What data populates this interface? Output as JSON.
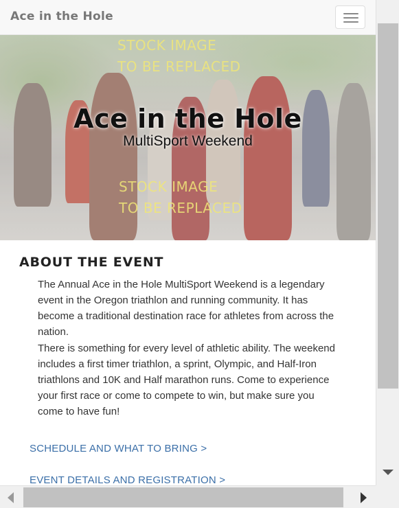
{
  "navbar": {
    "brand": "Ace in the Hole",
    "toggle_icon": "hamburger-menu-icon"
  },
  "hero": {
    "stock_top_line1": "STOCK IMAGE",
    "stock_top_line2": "TO BE REPLACED",
    "title": "Ace in the Hole",
    "subtitle": "MultiSport Weekend",
    "stock_bottom_line1": "STOCK IMAGE",
    "stock_bottom_line2": "TO BE REPLACED"
  },
  "about": {
    "heading": "ABOUT THE EVENT",
    "paragraph1": "The Annual Ace in the Hole MultiSport Weekend is a legendary event in the Oregon triathlon and running community. It has become a traditional destination race for athletes from across the nation.",
    "paragraph2": "There is something for every level of athletic ability. The weekend includes a first timer triathlon, a sprint, Olympic, and Half-Iron triathlons and 10K and Half marathon runs. Come to experience your first race or come to compete to win, but make sure you come to have fun!"
  },
  "links": {
    "schedule": "SCHEDULE AND WHAT TO BRING >",
    "registration": "EVENT DETAILS AND REGISTRATION >"
  },
  "colors": {
    "link": "#3b6fa8",
    "navbar_bg": "#f8f8f8",
    "stock_text": "#f0e678"
  }
}
